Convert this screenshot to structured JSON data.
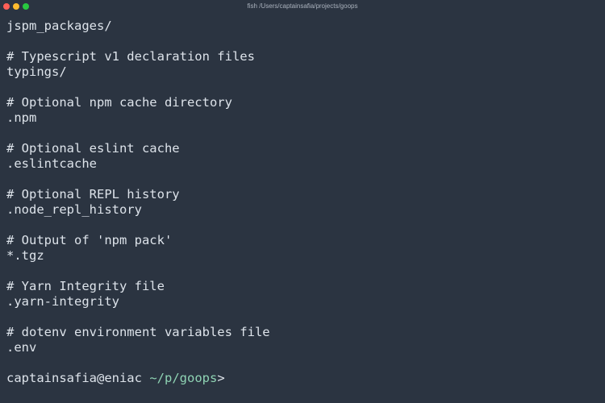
{
  "window": {
    "title": "fish /Users/captainsafia/projects/goops",
    "traffic_colors": {
      "close": "#fe5f57",
      "minimize": "#febc2e",
      "maximize": "#28c840"
    }
  },
  "terminal": {
    "lines": [
      "jspm_packages/",
      "",
      "# Typescript v1 declaration files",
      "typings/",
      "",
      "# Optional npm cache directory",
      ".npm",
      "",
      "# Optional eslint cache",
      ".eslintcache",
      "",
      "# Optional REPL history",
      ".node_repl_history",
      "",
      "# Output of 'npm pack'",
      "*.tgz",
      "",
      "# Yarn Integrity file",
      ".yarn-integrity",
      "",
      "# dotenv environment variables file",
      ".env"
    ],
    "prompt": {
      "user_host": "captainsafia@eniac",
      "cwd": "~/p/goops",
      "symbol": ">"
    }
  }
}
